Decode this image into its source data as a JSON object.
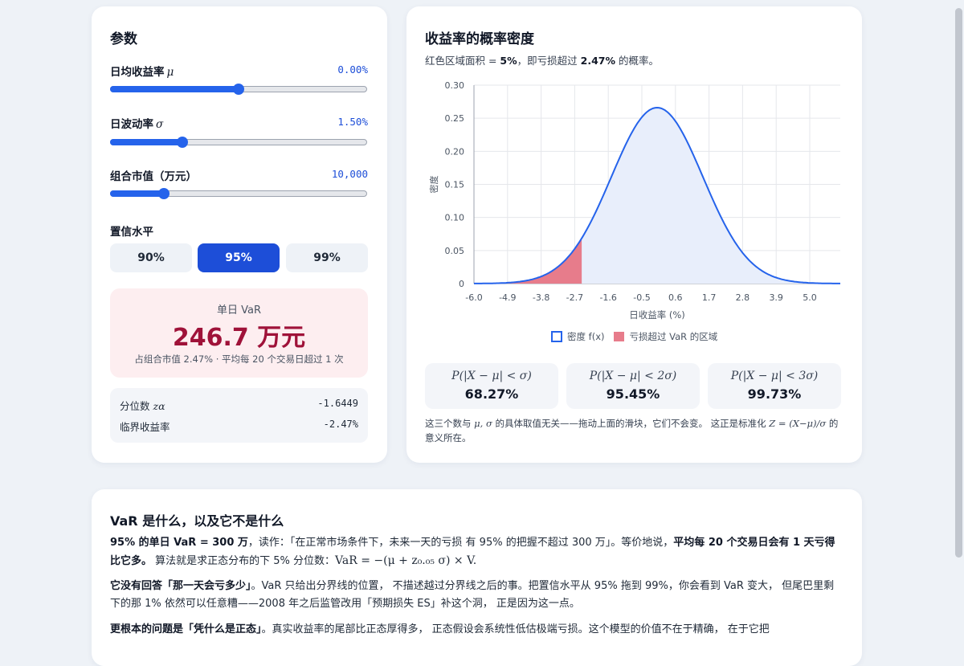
{
  "params": {
    "title": "参数",
    "mu": {
      "label": "日均收益率",
      "symbol": "μ",
      "value": "0.00%",
      "fraction": 0.5
    },
    "sigma": {
      "label": "日波动率",
      "symbol": "σ",
      "value": "1.50%",
      "fraction": 0.28
    },
    "portfolio": {
      "label": "组合市值（万元）",
      "value": "10,000",
      "fraction": 0.21
    },
    "confidence": {
      "label": "置信水平",
      "options": [
        "90%",
        "95%",
        "99%"
      ],
      "selected": "95%"
    },
    "var_result": {
      "label": "单日 VaR",
      "value": "246.7 万元",
      "detail": "占组合市值 2.47%  ·  平均每 20 个交易日超过 1 次"
    },
    "quantile": {
      "label": "分位数",
      "symbol": "zα",
      "value": "-1.6449"
    },
    "critical": {
      "label": "临界收益率",
      "value": "-2.47%"
    }
  },
  "chart": {
    "title": "收益率的概率密度",
    "subtitle_pre": "红色区域面积 = ",
    "subtitle_area": "5%",
    "subtitle_mid": "，即亏损超过 ",
    "subtitle_loss": "2.47%",
    "subtitle_post": " 的概率。",
    "legend": [
      "密度 f(x)",
      "亏损超过 VaR 的区域"
    ],
    "colors": {
      "line": "#2563eb",
      "fill": "#e8eefb",
      "tail": "#e77c8b"
    }
  },
  "chart_data": {
    "type": "area",
    "xlabel": "日收益率 (%)",
    "ylabel": "密度",
    "x_ticks": [
      "-6.0",
      "-4.9",
      "-3.8",
      "-2.7",
      "-1.6",
      "-0.5",
      "0.6",
      "1.7",
      "2.8",
      "3.9",
      "5.0"
    ],
    "y_ticks": [
      "0",
      "0.05",
      "0.10",
      "0.15",
      "0.20",
      "0.25",
      "0.30"
    ],
    "xlim": [
      -6.0,
      6.0
    ],
    "ylim": [
      0,
      0.3
    ],
    "series": [
      {
        "name": "密度 f(x)",
        "x": [
          -6.0,
          -5.0,
          -4.5,
          -4.0,
          -3.5,
          -3.0,
          -2.5,
          -2.0,
          -1.5,
          -1.0,
          -0.5,
          0.0,
          0.5,
          1.0,
          1.5,
          2.0,
          2.5,
          3.0,
          3.5,
          4.0,
          4.5,
          5.0,
          6.0
        ],
        "y": [
          0.0,
          0.0001,
          0.0012,
          0.0044,
          0.0129,
          0.031,
          0.065,
          0.1089,
          0.1613,
          0.2129,
          0.2518,
          0.2659,
          0.2518,
          0.2129,
          0.1613,
          0.1089,
          0.065,
          0.031,
          0.0129,
          0.0044,
          0.0012,
          0.0001,
          0.0
        ]
      },
      {
        "name": "亏损超过 VaR 的区域",
        "x_max": -2.47
      }
    ],
    "grid": true,
    "legend": "bottom"
  },
  "probabilities": [
    {
      "formula": "P(|X − μ| < σ)",
      "value": "68.27%"
    },
    {
      "formula": "P(|X − μ| < 2σ)",
      "value": "95.45%"
    },
    {
      "formula": "P(|X − μ| < 3σ)",
      "value": "99.73%"
    }
  ],
  "note": {
    "text1": "这三个数与 ",
    "math1": "μ, σ",
    "text2": " 的具体取值无关——拖动上面的滑块，它们不会变。 这正是标准化 ",
    "math2": "Z = (X−μ)/σ",
    "text3": " 的意义所在。"
  },
  "explain": {
    "title": "VaR 是什么，以及它不是什么",
    "p1": {
      "b1": "95% 的单日 VaR = 300 万",
      "t1": "，读作：「在正常市场条件下，未来一天的亏损 有 95% 的把握不超过 300 万」。等价地说，",
      "b2": "平均每 20 个交易日会有 1 天亏得比它多。",
      "t2": " 算法就是求正态分布的下 5% 分位数：",
      "math": "VaR = −(μ + z₀.₀₅ σ) × V."
    },
    "p2": {
      "b1": "它没有回答「那一天会亏多少」",
      "t1": "。VaR 只给出分界线的位置， 不描述越过分界线之后的事。把置信水平从 95% 拖到 99%，你会看到 VaR 变大， 但尾巴里剩下的那 1% 依然可以任意糟——2008 年之后监管改用「预期损失 ES」补这个洞， 正是因为这一点。"
    },
    "p3": {
      "b1": "更根本的问题是「凭什么是正态」",
      "t1": "。真实收益率的尾部比正态厚得多， 正态假设会系统性低估极端亏损。这个模型的价值不在于精确， 在于它把"
    }
  }
}
